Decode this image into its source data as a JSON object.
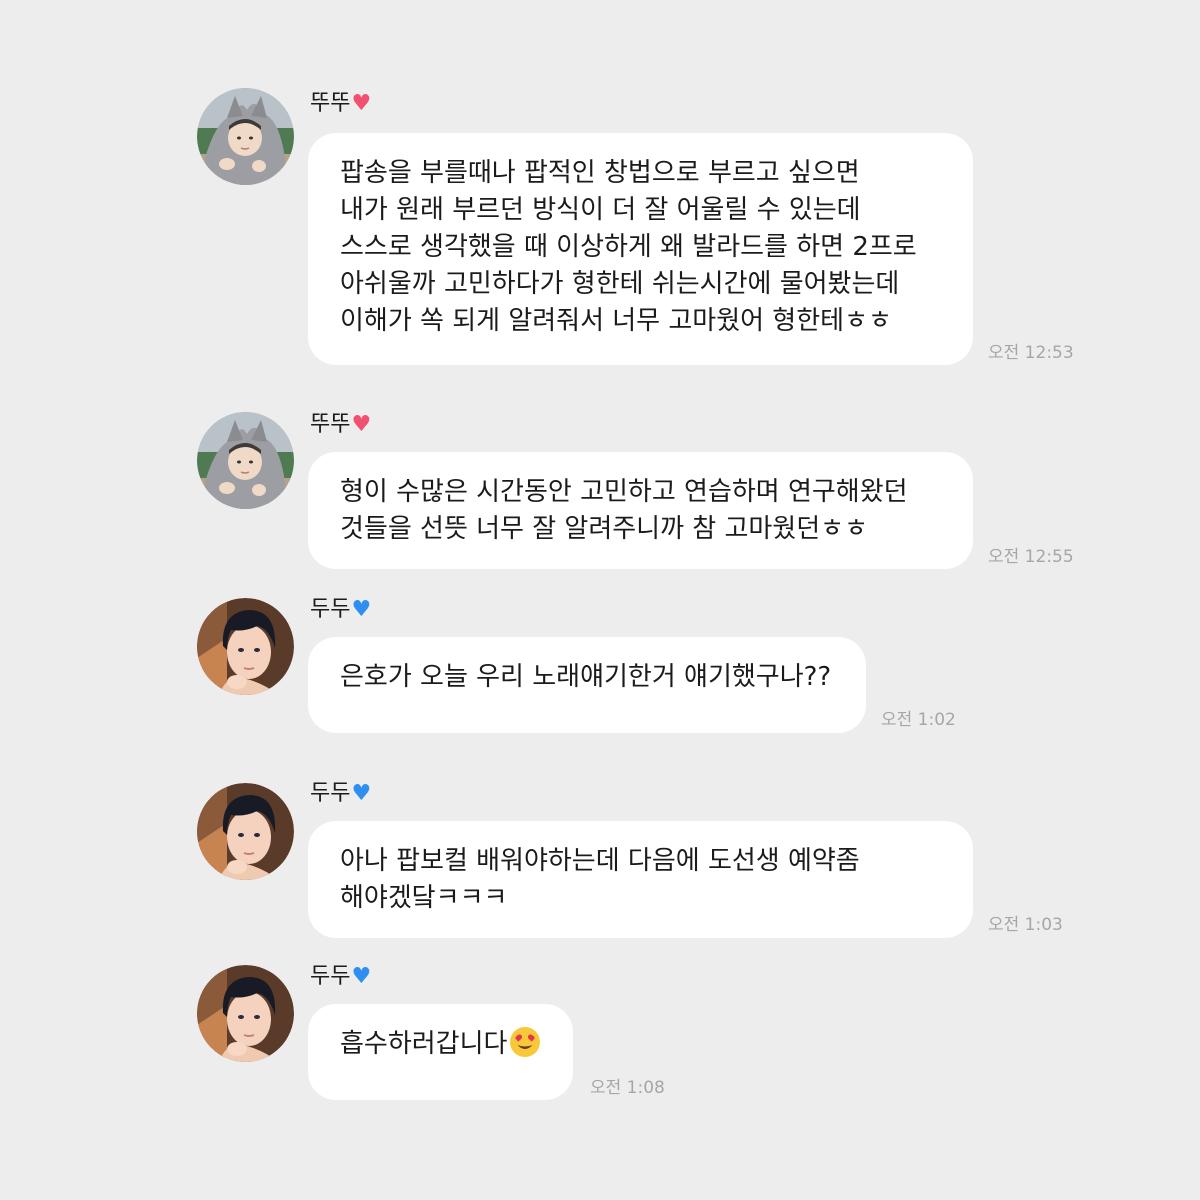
{
  "messages": [
    {
      "sender": "뚜뚜",
      "heart": "♥",
      "heart_color": "#f2506f",
      "avatar": "wolf-hood-avatar",
      "lines": [
        "팝송을 부를때나 팝적인 창법으로 부르고 싶으면",
        "내가 원래 부르던 방식이 더 잘 어울릴 수 있는데",
        "스스로 생각했을 때 이상하게 왜 발라드를 하면 2프로",
        "아쉬울까 고민하다가 형한테 쉬는시간에 물어봤는데",
        "이해가 쏙 되게 알려줘서 너무 고마웠어 형한테ㅎㅎ"
      ],
      "time": "오전 12:53"
    },
    {
      "sender": "뚜뚜",
      "heart": "♥",
      "heart_color": "#f2506f",
      "avatar": "wolf-hood-avatar",
      "lines": [
        "형이 수많은 시간동안 고민하고 연습하며 연구해왔던",
        "것들을 선뜻 너무 잘 알려주니까 참 고마웠던ㅎㅎ"
      ],
      "time": "오전 12:55"
    },
    {
      "sender": "두두",
      "heart": "♥",
      "heart_color": "#2f8ff0",
      "avatar": "dark-hair-boy-avatar",
      "lines": [
        "은호가 오늘 우리 노래얘기한거 얘기했구나??"
      ],
      "time": "오전 1:02"
    },
    {
      "sender": "두두",
      "heart": "♥",
      "heart_color": "#2f8ff0",
      "avatar": "dark-hair-boy-avatar",
      "lines": [
        "아나 팝보컬 배워야하는데 다음에 도선생 예약좀",
        "해야겠닼ㅋㅋㅋ"
      ],
      "time": "오전 1:03"
    },
    {
      "sender": "두두",
      "heart": "♥",
      "heart_color": "#2f8ff0",
      "avatar": "dark-hair-boy-avatar",
      "lines": [
        "흡수하러갑니다"
      ],
      "emoji": "heart-eyes-emoji",
      "time": "오전 1:08"
    }
  ]
}
